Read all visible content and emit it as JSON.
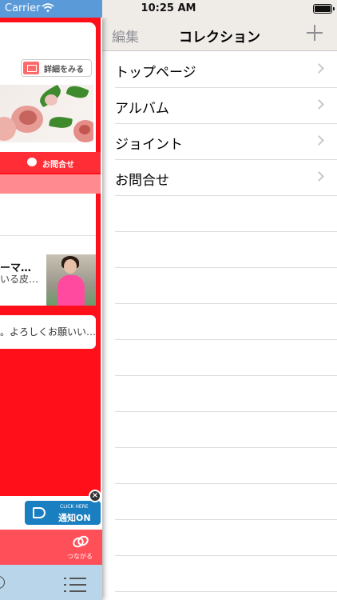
{
  "status_bar": {
    "carrier": "Carrier",
    "time": "10:25 AM"
  },
  "nav": {
    "edit_label": "編集",
    "title": "コレクション"
  },
  "collection_items": [
    {
      "label": "トップページ"
    },
    {
      "label": "アルバム"
    },
    {
      "label": "ジョイント"
    },
    {
      "label": "お問合せ"
    }
  ],
  "left_app": {
    "detail_button": "詳細をみる",
    "contact_label": "お問合せ",
    "news_title": "ーマ…",
    "news_sub": "いる皮…",
    "greeting": "。よろしくお願いい…",
    "notify_small": "CLICK HERE",
    "notify_big": "通知ON",
    "notify_close": "×",
    "link_label": "つながる"
  },
  "colors": {
    "accent_red": "#ff0f1a",
    "notify_blue": "#1a7fc1",
    "nav_bg": "#efece8"
  }
}
